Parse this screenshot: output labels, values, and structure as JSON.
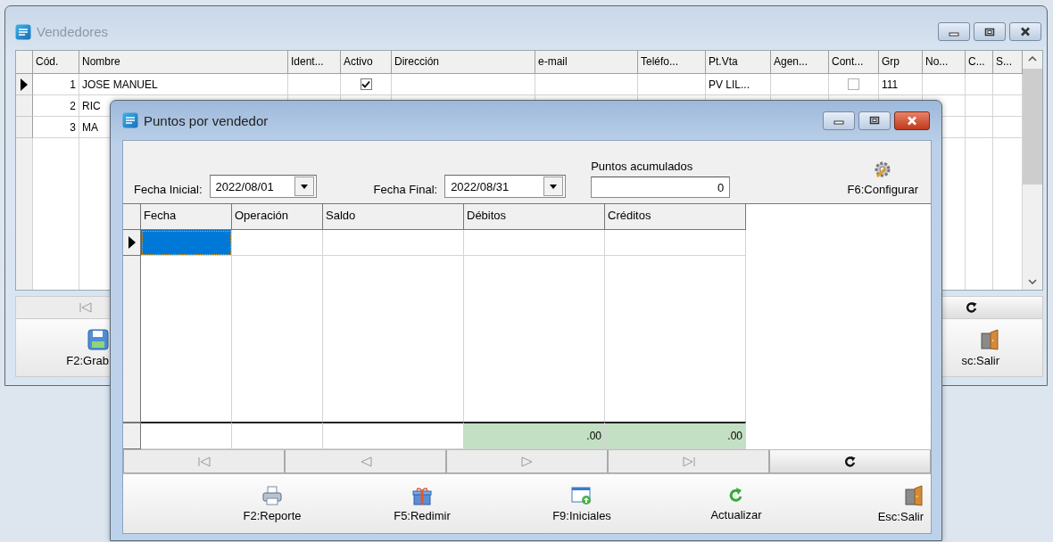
{
  "background_window": {
    "title": "Vendedores",
    "columns": [
      "Cód.",
      "Nombre",
      "Ident...",
      "Activo",
      "Dirección",
      "e-mail",
      "Teléfo...",
      "Pt.Vta",
      "Agen...",
      "Cont...",
      "Grp",
      "No...",
      "C...",
      "S..."
    ],
    "rows": [
      {
        "current": true,
        "cod": "1",
        "nombre": "JOSE MANUEL",
        "activo": true,
        "pt_vta": "PV LIL...",
        "cont": false,
        "grp": "111"
      },
      {
        "current": false,
        "cod": "2",
        "nombre": "RIC"
      },
      {
        "current": false,
        "cod": "3",
        "nombre": "MA"
      }
    ],
    "nav_buttons": [
      {
        "kind": "first",
        "disabled": true
      },
      {
        "kind": "refresh",
        "disabled": false
      }
    ],
    "toolbar": [
      {
        "kind": "save",
        "label": "F2:Grab"
      },
      {
        "kind": "exit",
        "label": "sc:Salir"
      }
    ]
  },
  "dialog": {
    "title": "Puntos por vendedor",
    "fecha_inicial": {
      "label": "Fecha Inicial:",
      "value": "2022/08/01"
    },
    "fecha_final": {
      "label": "Fecha Final:",
      "value": "2022/08/31"
    },
    "puntos": {
      "label": "Puntos acumulados",
      "value": "0"
    },
    "configure_button": "F6:Configurar",
    "table": {
      "columns": [
        "Fecha",
        "Operación",
        "Saldo",
        "Débitos",
        "Créditos"
      ],
      "rows": [
        {
          "current": true,
          "cells": [
            {
              "selected": true
            },
            {
              "selected": false
            },
            {
              "selected": false
            },
            {
              "selected": false
            },
            {
              "selected": false
            }
          ]
        }
      ],
      "totals": {
        "debitos": ".00",
        "creditos": ".00"
      }
    },
    "nav_buttons": [
      {
        "kind": "first",
        "disabled": true
      },
      {
        "kind": "prev",
        "disabled": true
      },
      {
        "kind": "next",
        "disabled": true
      },
      {
        "kind": "last",
        "disabled": true
      },
      {
        "kind": "refresh",
        "disabled": false
      }
    ],
    "toolbar": [
      {
        "kind": "print",
        "label": "F2:Reporte"
      },
      {
        "kind": "gift",
        "label": "F5:Redimir"
      },
      {
        "kind": "window",
        "label": "F9:Iniciales"
      },
      {
        "kind": "refresh",
        "label": "Actualizar"
      },
      {
        "kind": "exit",
        "label": "Esc:Salir"
      }
    ]
  }
}
